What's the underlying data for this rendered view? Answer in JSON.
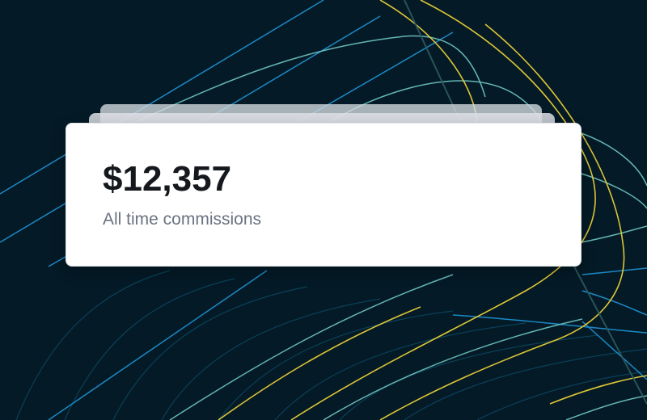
{
  "stat_card": {
    "amount": "$12,357",
    "caption": "All time commissions"
  },
  "colors": {
    "background": "#041a26",
    "card_background": "#ffffff",
    "amount_text": "#15181c",
    "caption_text": "#6b7280",
    "line_yellow": "#e9cf38",
    "line_teal": "#6fc7c4",
    "line_blue": "#1e96d8"
  }
}
